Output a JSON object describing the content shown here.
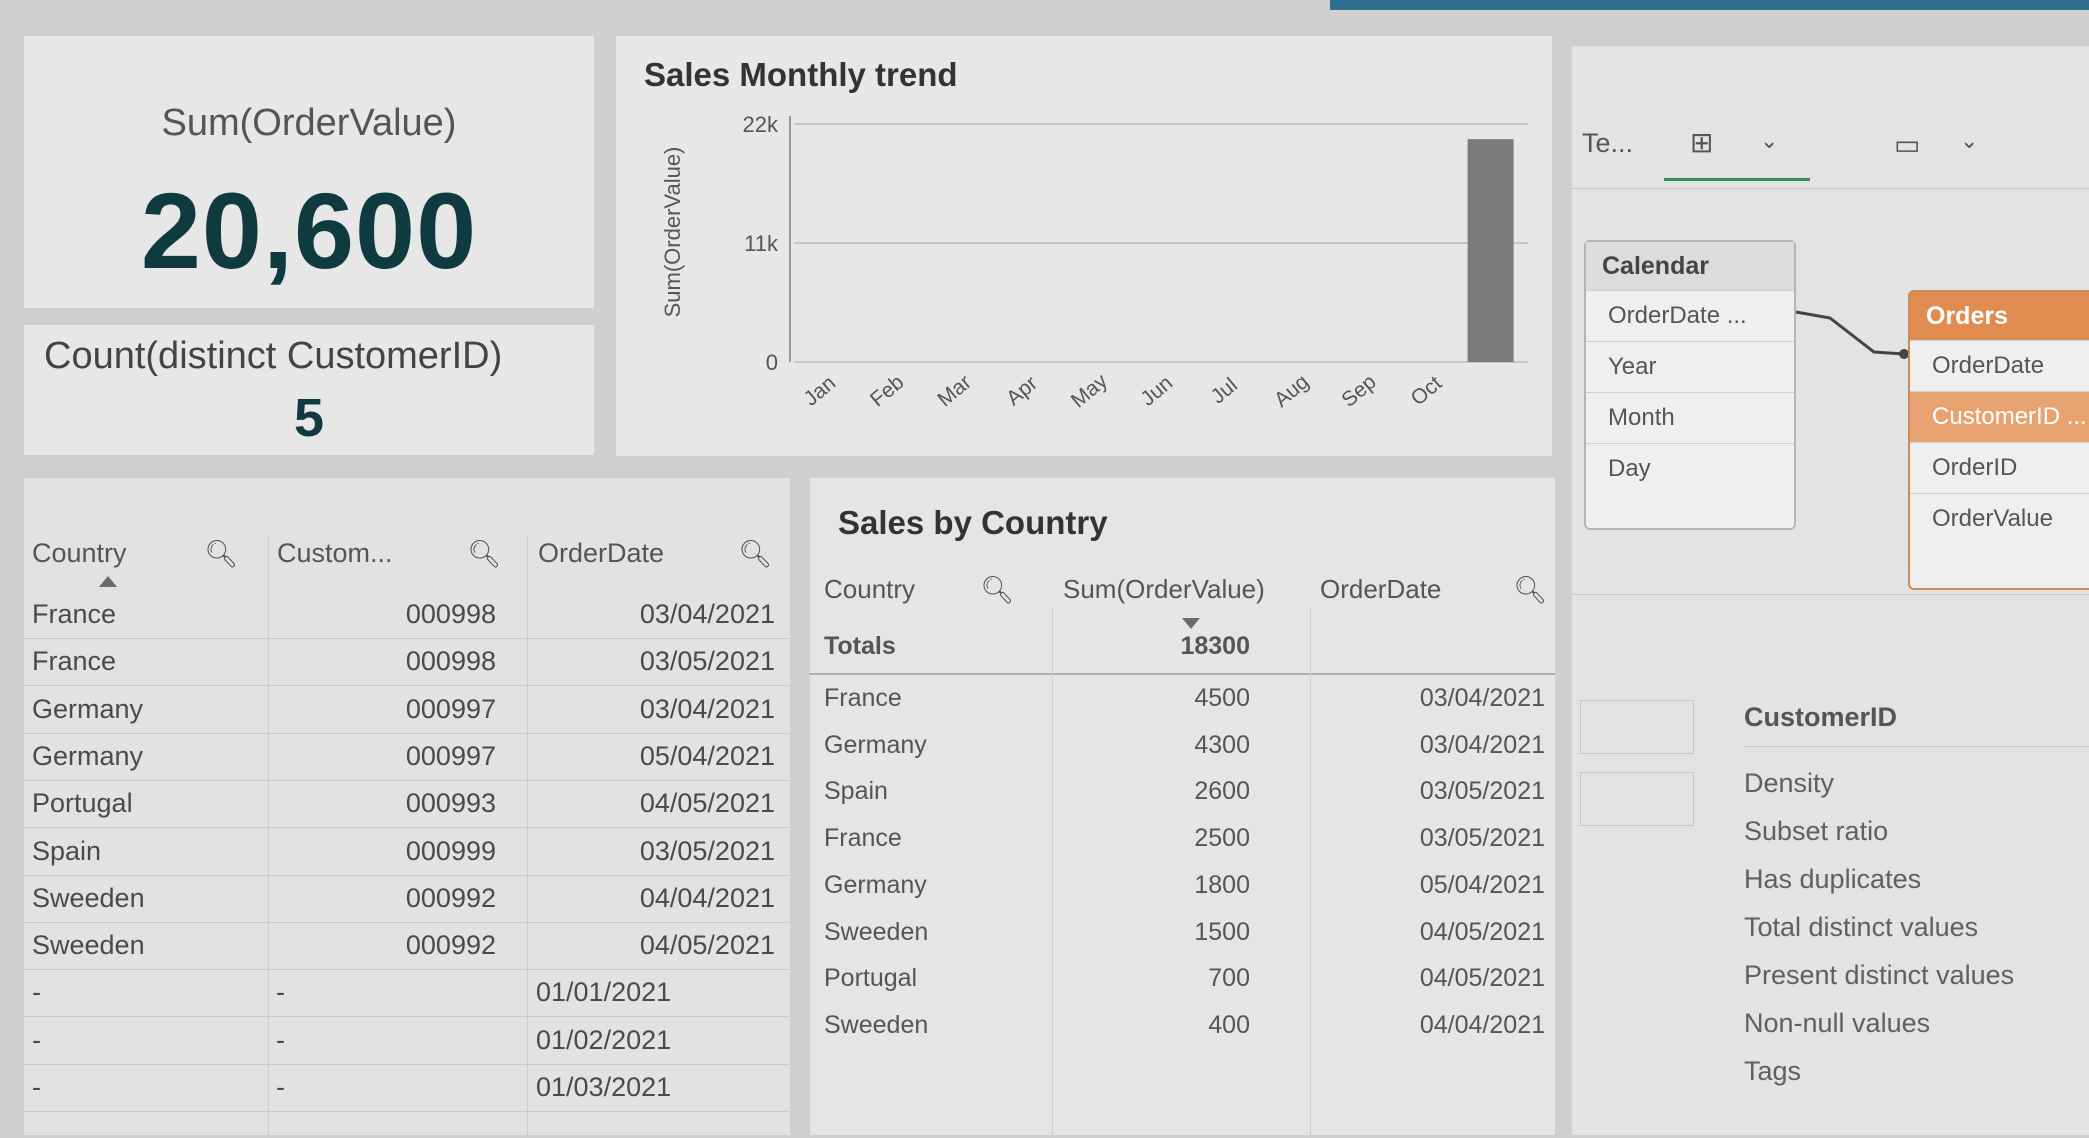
{
  "kpi_total": {
    "label": "Sum(OrderValue)",
    "value": "20,600"
  },
  "kpi_customers": {
    "label": "Count(distinct CustomerID)",
    "value": "5"
  },
  "trend": {
    "title": "Sales Monthly trend"
  },
  "chart_data": {
    "type": "bar",
    "title": "Sales Monthly trend",
    "ylabel": "Sum(OrderValue)",
    "xlabel": "",
    "categories": [
      "Jan",
      "Feb",
      "Mar",
      "Apr",
      "May",
      "Jun",
      "Jul",
      "Aug",
      "Sep",
      "Oct"
    ],
    "values": [
      0,
      0,
      0,
      0,
      0,
      0,
      0,
      0,
      0,
      20600
    ],
    "y_tick_labels": [
      "22k",
      "11k",
      "0"
    ],
    "ylim": [
      0,
      22000
    ],
    "grid": true,
    "accent_color": "#7b7b7b"
  },
  "orders_table": {
    "columns": [
      "Country",
      "Custom...",
      "OrderDate"
    ],
    "rows": [
      [
        "France",
        "000998",
        "03/04/2021"
      ],
      [
        "France",
        "000998",
        "03/05/2021"
      ],
      [
        "Germany",
        "000997",
        "03/04/2021"
      ],
      [
        "Germany",
        "000997",
        "05/04/2021"
      ],
      [
        "Portugal",
        "000993",
        "04/05/2021"
      ],
      [
        "Spain",
        "000999",
        "03/05/2021"
      ],
      [
        "Sweeden",
        "000992",
        "04/04/2021"
      ],
      [
        "Sweeden",
        "000992",
        "04/05/2021"
      ],
      [
        "-",
        "-",
        "01/01/2021"
      ],
      [
        "-",
        "-",
        "01/02/2021"
      ],
      [
        "-",
        "-",
        "01/03/2021"
      ]
    ]
  },
  "country_table": {
    "title": "Sales by Country",
    "columns": [
      "Country",
      "Sum(OrderValue)",
      "OrderDate"
    ],
    "totals_label": "Totals",
    "totals_value": "18300",
    "rows": [
      [
        "France",
        "4500",
        "03/04/2021"
      ],
      [
        "Germany",
        "4300",
        "03/04/2021"
      ],
      [
        "Spain",
        "2600",
        "03/05/2021"
      ],
      [
        "France",
        "2500",
        "03/05/2021"
      ],
      [
        "Germany",
        "1800",
        "05/04/2021"
      ],
      [
        "Sweeden",
        "1500",
        "04/05/2021"
      ],
      [
        "Portugal",
        "700",
        "04/05/2021"
      ],
      [
        "Sweeden",
        "400",
        "04/04/2021"
      ]
    ]
  },
  "model": {
    "toolbar_tab": "Te...",
    "calendar": {
      "name": "Calendar",
      "fields": [
        "OrderDate ...",
        "Year",
        "Month",
        "Day"
      ]
    },
    "orders": {
      "name": "Orders",
      "fields": [
        "OrderDate",
        "CustomerID ...",
        "OrderID",
        "OrderValue"
      ]
    },
    "props_title": "CustomerID",
    "props": [
      "Density",
      "Subset ratio",
      "Has duplicates",
      "Total distinct values",
      "Present distinct values",
      "Non-null values",
      "Tags"
    ],
    "orders_color": "#e08b4f"
  }
}
